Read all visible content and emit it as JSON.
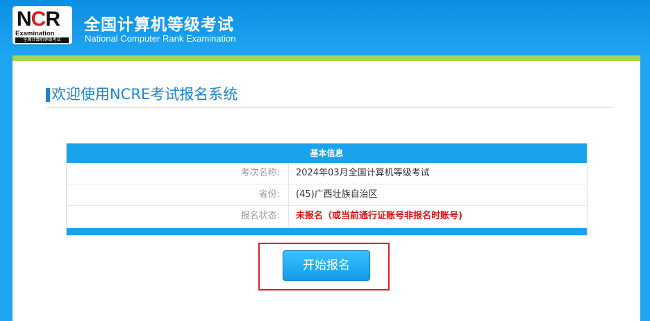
{
  "header": {
    "logo_letters_1": "N",
    "logo_letters_2": "C",
    "logo_letters_3": "R",
    "logo_sub": "Examination",
    "logo_bar": "全国计算机等级考试",
    "title": "全国计算机等级考试",
    "subtitle": "National Computer Rank Examination"
  },
  "main": {
    "welcome": "欢迎使用NCRE考试报名系统",
    "info": {
      "header": "基本信息",
      "rows": [
        {
          "label": "考次名称:",
          "value": "2024年03月全国计算机等级考试"
        },
        {
          "label": "省份:",
          "value": "(45)广西壮族自治区"
        },
        {
          "label": "报名状态:",
          "value": "未报名（或当前通行证账号非报名时账号)"
        }
      ]
    },
    "start_button": "开始报名"
  },
  "colors": {
    "header_blue": "#1fa6f2",
    "green_band": "#a6d653",
    "accent_blue": "#1a86d0",
    "status_red": "#dd1111",
    "highlight_red": "#e02020"
  }
}
